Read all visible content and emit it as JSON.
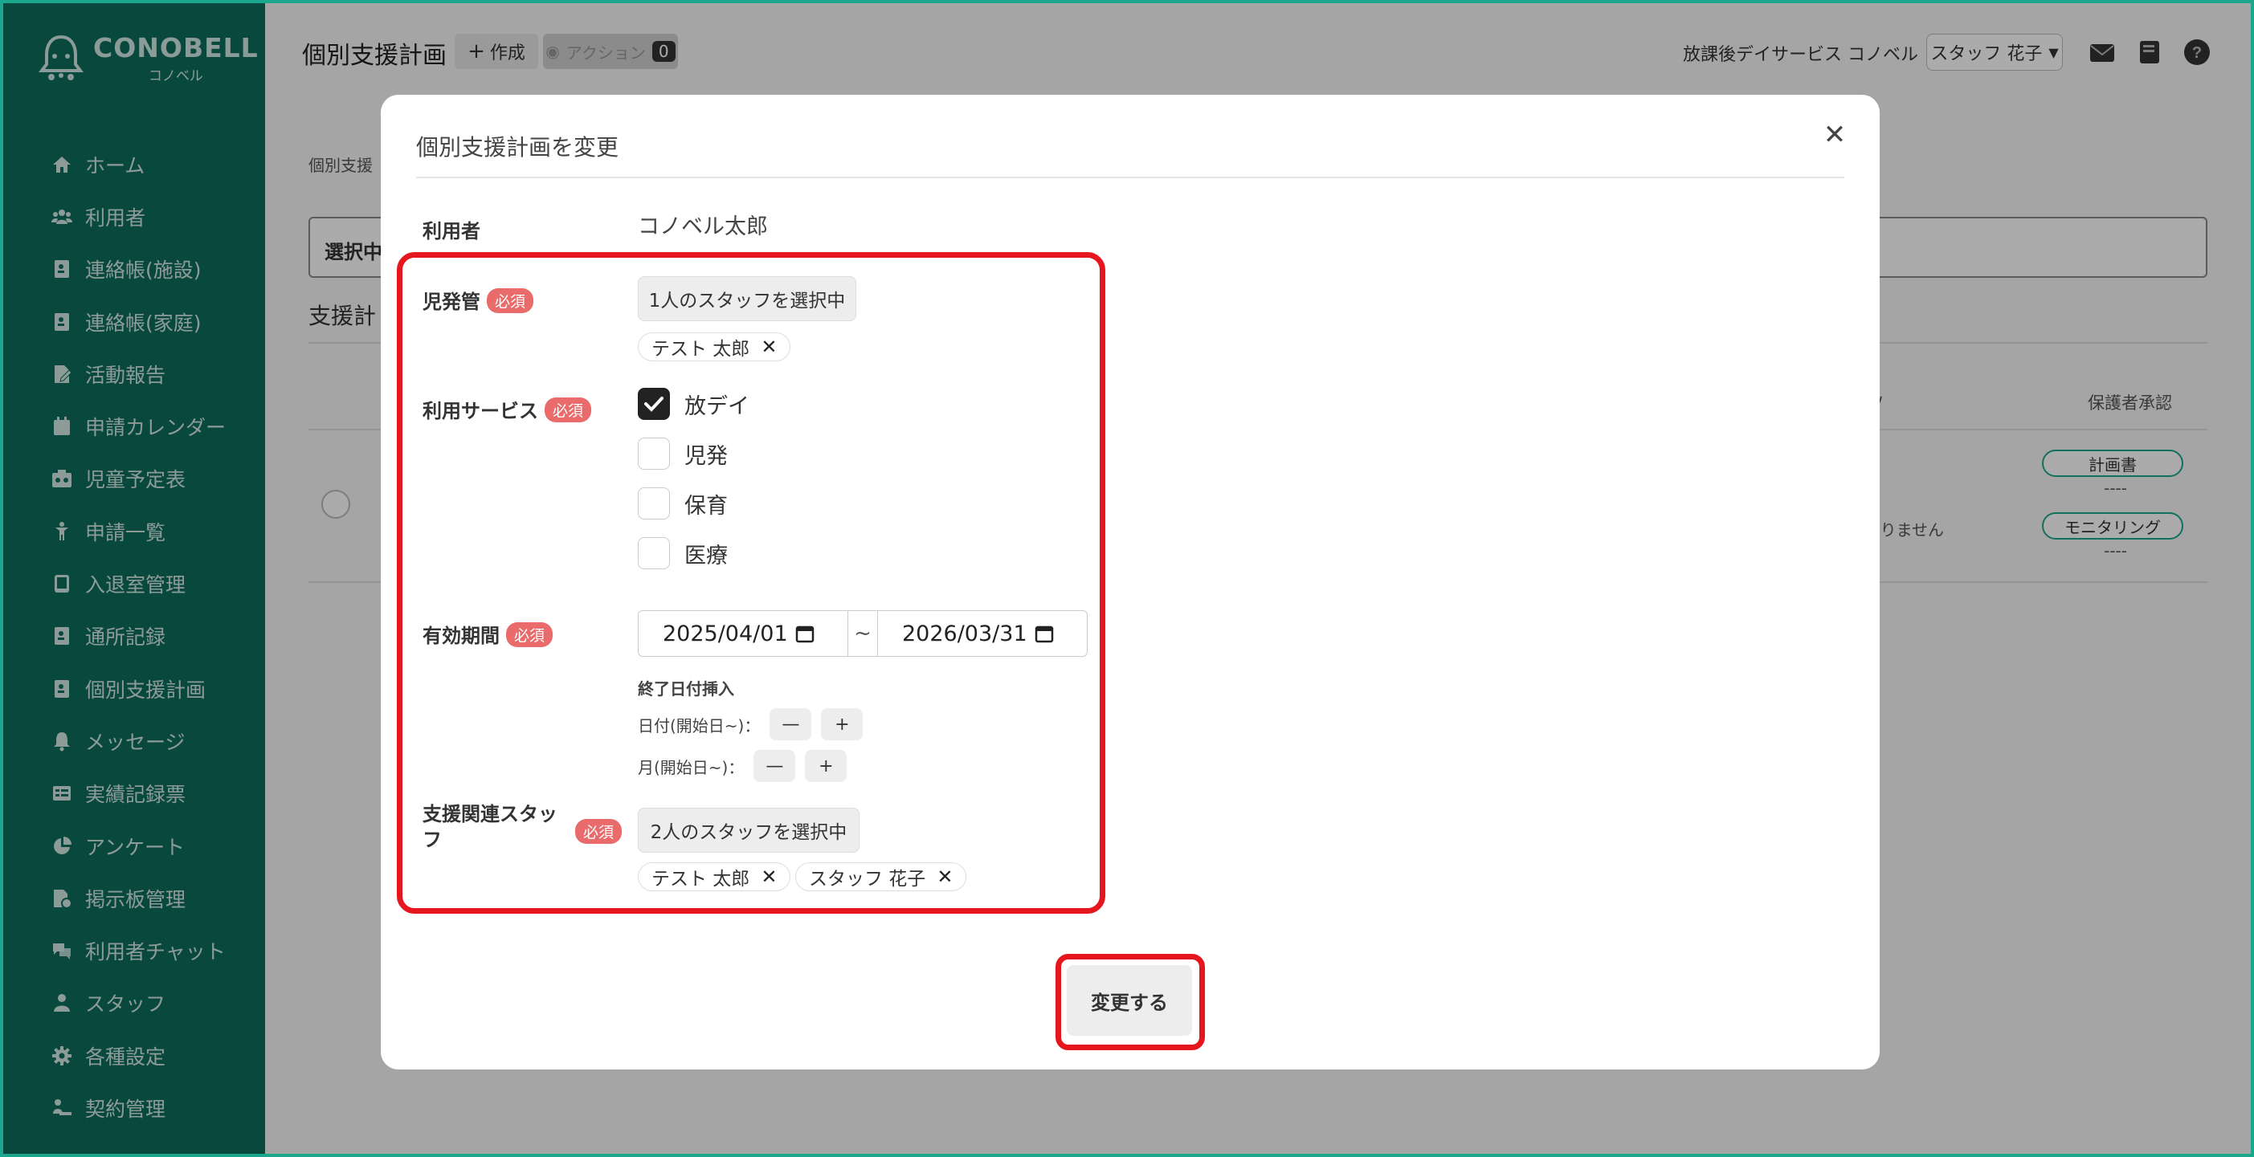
{
  "brand": {
    "name": "CONOBELL",
    "sub": "コノベル"
  },
  "sidebar": {
    "items": [
      {
        "label": "ホーム",
        "icon": "home-icon"
      },
      {
        "label": "利用者",
        "icon": "users-icon"
      },
      {
        "label": "連絡帳(施設)",
        "icon": "contact-book-icon"
      },
      {
        "label": "連絡帳(家庭)",
        "icon": "contact-book-icon"
      },
      {
        "label": "活動報告",
        "icon": "report-icon"
      },
      {
        "label": "申請カレンダー",
        "icon": "calendar-icon"
      },
      {
        "label": "児童予定表",
        "icon": "schedule-icon"
      },
      {
        "label": "申請一覧",
        "icon": "child-icon"
      },
      {
        "label": "入退室管理",
        "icon": "tablet-icon"
      },
      {
        "label": "通所記録",
        "icon": "contact-book-icon"
      },
      {
        "label": "個別支援計画",
        "icon": "contact-book-icon"
      },
      {
        "label": "メッセージ",
        "icon": "bell-icon"
      },
      {
        "label": "実績記録票",
        "icon": "table-icon"
      },
      {
        "label": "アンケート",
        "icon": "pie-chart-icon"
      },
      {
        "label": "掲示板管理",
        "icon": "board-icon"
      },
      {
        "label": "利用者チャット",
        "icon": "chat-icon"
      },
      {
        "label": "スタッフ",
        "icon": "staff-icon"
      },
      {
        "label": "各種設定",
        "icon": "gear-icon"
      },
      {
        "label": "契約管理",
        "icon": "contract-icon"
      }
    ]
  },
  "topbar": {
    "title": "個別支援計画",
    "create_label": "作成",
    "action_label": "アクション",
    "action_count": "0",
    "facility": "放課後デイサービス コノベル",
    "staff_select": "スタッフ 花子"
  },
  "background": {
    "breadcrumb": "個別支援",
    "select_text": "選択中",
    "section": "支援計",
    "col_guardian": "保護者承認",
    "pill_plan": "計画書",
    "pill_monitoring": "モニタリング",
    "dash": "----",
    "none_text": "ありません",
    "partial_v": "ソ"
  },
  "modal": {
    "title": "個別支援計画を変更",
    "user_label": "利用者",
    "user_value": "コノベル太郎",
    "required": "必須",
    "jihatsukan_label": "児発管",
    "jihatsukan_button": "1人のスタッフを選択中",
    "jihatsukan_chips": [
      "テスト 太郎"
    ],
    "service_label": "利用サービス",
    "services": [
      {
        "label": "放デイ",
        "checked": true
      },
      {
        "label": "児発",
        "checked": false
      },
      {
        "label": "保育",
        "checked": false
      },
      {
        "label": "医療",
        "checked": false
      }
    ],
    "period_label": "有効期間",
    "start_date": "2025/04/01",
    "end_date": "2026/03/31",
    "date_sep": "~",
    "end_insert_label": "終了日付挿入",
    "day_row_label": "日付(開始日~)：",
    "month_row_label": "月(開始日~)：",
    "minus": "—",
    "plus": "+",
    "support_staff_label": "支援関連スタッフ",
    "support_staff_button": "2人のスタッフを選択中",
    "support_staff_chips": [
      "テスト 太郎",
      "スタッフ 花子"
    ],
    "submit_label": "変更する"
  },
  "colors": {
    "sidebar": "#0e6e5c",
    "accent": "#1aa78d",
    "required": "#e96b6b",
    "highlight": "#e5161d"
  }
}
